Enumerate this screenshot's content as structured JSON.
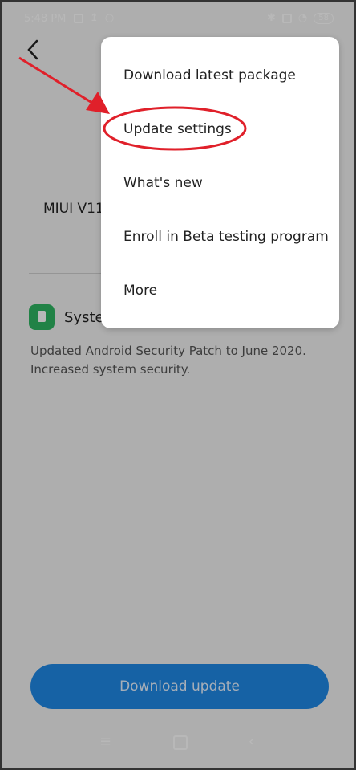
{
  "statusbar": {
    "time": "5:48 PM",
    "battery": "58"
  },
  "icons": {
    "back": "back-chevron-icon",
    "system": "system-update-icon",
    "bluetooth": "bluetooth-icon",
    "wifi": "wifi-icon",
    "upload": "upload-icon",
    "notify": "notification-icon"
  },
  "main": {
    "version_label": "MIUI V11.",
    "update_section": {
      "title": "Syste",
      "notes": [
        "Updated Android Security Patch to June 2020.",
        "Increased system security."
      ]
    },
    "primary_button": "Download update"
  },
  "menu": {
    "items": [
      {
        "label": "Download latest package"
      },
      {
        "label": "Update settings"
      },
      {
        "label": "What's new"
      },
      {
        "label": "Enroll in Beta testing program"
      },
      {
        "label": "More"
      }
    ]
  },
  "navbar": {
    "menu_glyph": "≡",
    "back_glyph": "‹"
  },
  "colors": {
    "accent": "#1f88e5",
    "annotation": "#e0202a",
    "app_icon": "#2fb462"
  }
}
